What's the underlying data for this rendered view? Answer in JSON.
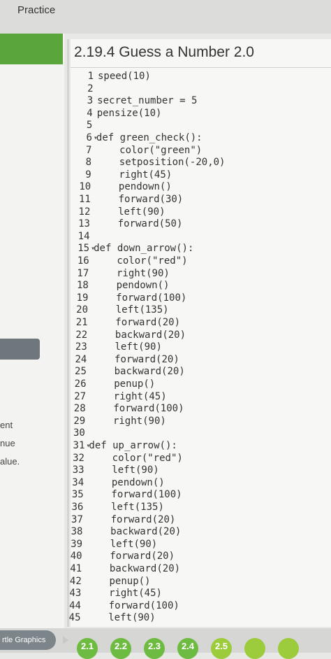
{
  "header": {
    "title": "Practice"
  },
  "side": {
    "labels": [
      "ent",
      "nue",
      "alue."
    ]
  },
  "editor": {
    "title": "2.19.4 Guess a Number 2.0",
    "lines": [
      {
        "n": "1",
        "code": "speed(10)"
      },
      {
        "n": "2",
        "code": ""
      },
      {
        "n": "3",
        "code": "secret_number = 5"
      },
      {
        "n": "4",
        "code": "pensize(10)"
      },
      {
        "n": "5",
        "code": ""
      },
      {
        "n": "6",
        "code": "def green_check():"
      },
      {
        "n": "7",
        "code": "    color(\"green\")"
      },
      {
        "n": "8",
        "code": "    setposition(-20,0)"
      },
      {
        "n": "9",
        "code": "    right(45)"
      },
      {
        "n": "10",
        "code": "    pendown()"
      },
      {
        "n": "11",
        "code": "    forward(30)"
      },
      {
        "n": "12",
        "code": "    left(90)"
      },
      {
        "n": "13",
        "code": "    forward(50)"
      },
      {
        "n": "14",
        "code": ""
      },
      {
        "n": "15",
        "code": "def down_arrow():"
      },
      {
        "n": "16",
        "code": "    color(\"red\")"
      },
      {
        "n": "17",
        "code": "    right(90)"
      },
      {
        "n": "18",
        "code": "    pendown()"
      },
      {
        "n": "19",
        "code": "    forward(100)"
      },
      {
        "n": "20",
        "code": "    left(135)"
      },
      {
        "n": "21",
        "code": "    forward(20)"
      },
      {
        "n": "22",
        "code": "    backward(20)"
      },
      {
        "n": "23",
        "code": "    left(90)"
      },
      {
        "n": "24",
        "code": "    forward(20)"
      },
      {
        "n": "25",
        "code": "    backward(20)"
      },
      {
        "n": "26",
        "code": "    penup()"
      },
      {
        "n": "27",
        "code": "    right(45)"
      },
      {
        "n": "28",
        "code": "    forward(100)"
      },
      {
        "n": "29",
        "code": "    right(90)"
      },
      {
        "n": "30",
        "code": ""
      },
      {
        "n": "31",
        "code": "def up_arrow():"
      },
      {
        "n": "32",
        "code": "    color(\"red\")"
      },
      {
        "n": "33",
        "code": "    left(90)"
      },
      {
        "n": "34",
        "code": "    pendown()"
      },
      {
        "n": "35",
        "code": "    forward(100)"
      },
      {
        "n": "36",
        "code": "    left(135)"
      },
      {
        "n": "37",
        "code": "    forward(20)"
      },
      {
        "n": "38",
        "code": "    backward(20)"
      },
      {
        "n": "39",
        "code": "    left(90)"
      },
      {
        "n": "40",
        "code": "    forward(20)"
      },
      {
        "n": "41",
        "code": "    backward(20)"
      },
      {
        "n": "42",
        "code": "    penup()"
      },
      {
        "n": "43",
        "code": "    right(45)"
      },
      {
        "n": "44",
        "code": "    forward(100)"
      },
      {
        "n": "45",
        "code": "    left(90)"
      }
    ]
  },
  "bottom": {
    "tab_label": "rtle Graphics",
    "pills": [
      "2.1",
      "2.2",
      "2.3",
      "2.4",
      "2.5",
      "",
      ""
    ]
  },
  "colors": {
    "accent_green": "#5aa63c",
    "pill_green": "#6dbb40",
    "pill_green_light": "#9ccc3b",
    "dark_button": "#6f767c"
  }
}
